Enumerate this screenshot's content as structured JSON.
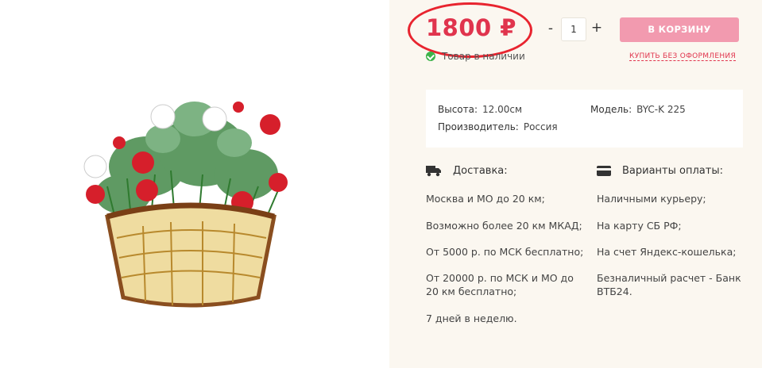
{
  "product": {
    "price": "1800 ₽",
    "stock_status": "Товар в наличии",
    "quantity": "1",
    "qty_minus": "-",
    "qty_plus": "+",
    "cart_button": "В КОРЗИНУ",
    "oneclick_link": "КУПИТЬ БЕЗ ОФОРМЛЕНИЯ"
  },
  "specs": {
    "height_label": "Высота:",
    "height_value": "12.00см",
    "model_label": "Модель:",
    "model_value": "BYC-K 225",
    "maker_label": "Производитель:",
    "maker_value": "Россия"
  },
  "delivery": {
    "title": "Доставка:",
    "items": [
      "Москва и МО до 20 км;",
      "Возможно более 20 км МКАД;",
      "От 5000 р. по МСК бесплатно;",
      "От 20000 р. по МСК и МО до 20 км бесплатно;",
      "7 дней в неделю."
    ]
  },
  "payment": {
    "title": "Варианты оплаты:",
    "items": [
      "Наличными курьеру;",
      "На карту СБ РФ;",
      "На счет Яндекс-кошелька;",
      "Безналичный расчет - Банк ВТБ24."
    ]
  },
  "colors": {
    "price": "#e0344d",
    "cart_button": "#f29aaf",
    "annotation_circle": "#e8242f",
    "in_stock": "#3cb34a",
    "panel_bg": "#fbf7f0"
  },
  "icons": {
    "stock": "check-circle-icon",
    "delivery": "truck-icon",
    "payment": "credit-card-icon"
  }
}
